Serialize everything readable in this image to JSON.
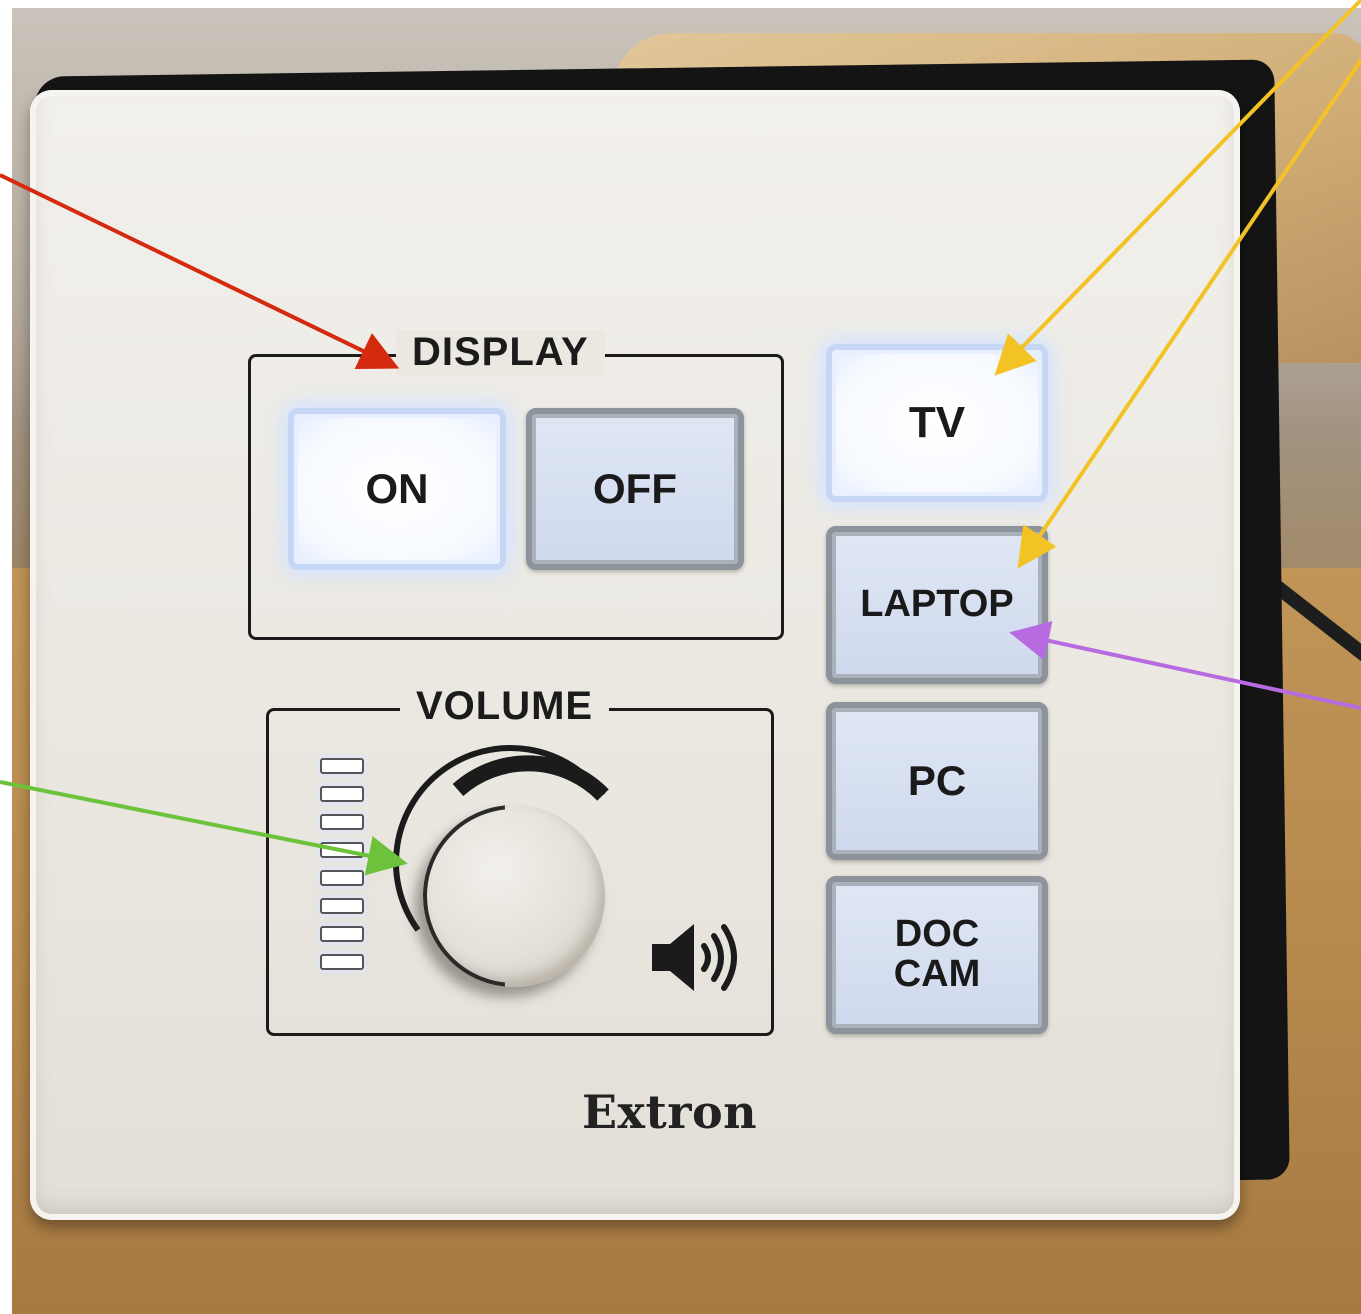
{
  "device": {
    "brand": "Extron",
    "display_group": {
      "label": "DISPLAY",
      "on_label": "ON",
      "off_label": "OFF"
    },
    "source_buttons": [
      {
        "line1": "TV",
        "line2": ""
      },
      {
        "line1": "LAPTOP",
        "line2": ""
      },
      {
        "line1": "PC",
        "line2": ""
      },
      {
        "line1": "DOC",
        "line2": "CAM"
      }
    ],
    "volume_group": {
      "label": "VOLUME",
      "led_count": 8,
      "speaker_icon": "speaker-icon"
    }
  },
  "annotation_colors": {
    "display_arrow": "#d42a10",
    "source_arrows": "#f3c326",
    "laptop_arrow": "#b86be0",
    "volume_arrow": "#6cc23a"
  }
}
